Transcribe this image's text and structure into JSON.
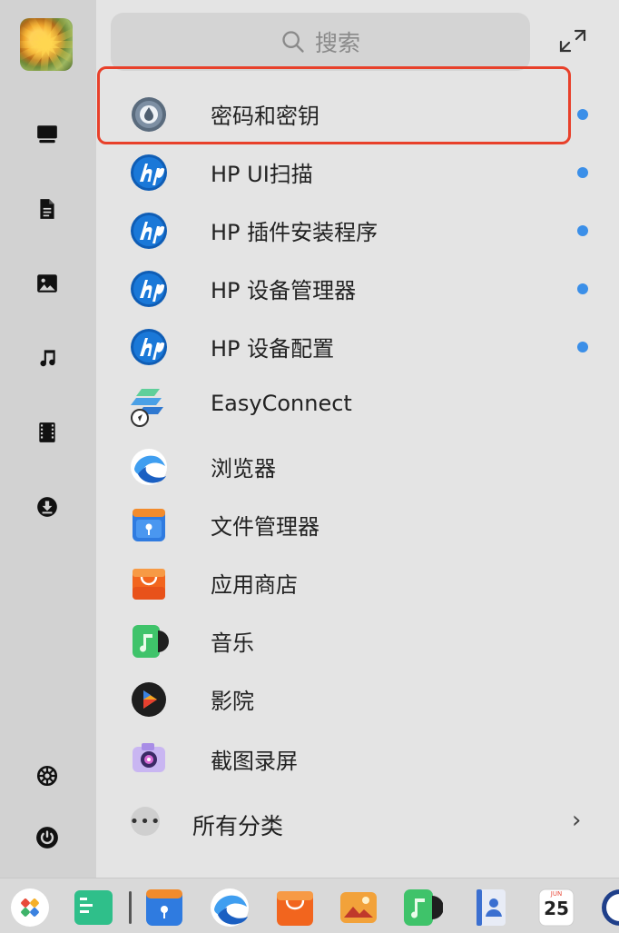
{
  "search": {
    "placeholder": "搜索"
  },
  "apps": [
    {
      "label": "密码和密钥",
      "icon": "password-keys-icon",
      "new": true
    },
    {
      "label": "HP UI扫描",
      "icon": "hp-icon",
      "new": true
    },
    {
      "label": "HP 插件安装程序",
      "icon": "hp-icon",
      "new": true
    },
    {
      "label": "HP 设备管理器",
      "icon": "hp-icon",
      "new": true
    },
    {
      "label": "HP 设备配置",
      "icon": "hp-icon",
      "new": true
    },
    {
      "label": "EasyConnect",
      "icon": "easyconnect-icon",
      "new": false
    },
    {
      "label": "浏览器",
      "icon": "browser-icon",
      "new": false
    },
    {
      "label": "文件管理器",
      "icon": "file-manager-icon",
      "new": false
    },
    {
      "label": "应用商店",
      "icon": "app-store-icon",
      "new": false
    },
    {
      "label": "音乐",
      "icon": "music-app-icon",
      "new": false
    },
    {
      "label": "影院",
      "icon": "movie-app-icon",
      "new": false
    },
    {
      "label": "截图录屏",
      "icon": "screenshot-app-icon",
      "new": false
    }
  ],
  "all_categories": {
    "label": "所有分类",
    "more_glyph": "•••",
    "chevron": "›"
  },
  "sidebar": [
    "computer-icon",
    "document-icon",
    "picture-icon",
    "music-icon",
    "video-icon",
    "download-icon",
    "settings-icon",
    "power-icon"
  ],
  "taskbar": {
    "calendar_month": "JUN",
    "calendar_day": "25"
  },
  "colors": {
    "new_dot": "#3b8fe8",
    "highlight": "#e8402a"
  }
}
